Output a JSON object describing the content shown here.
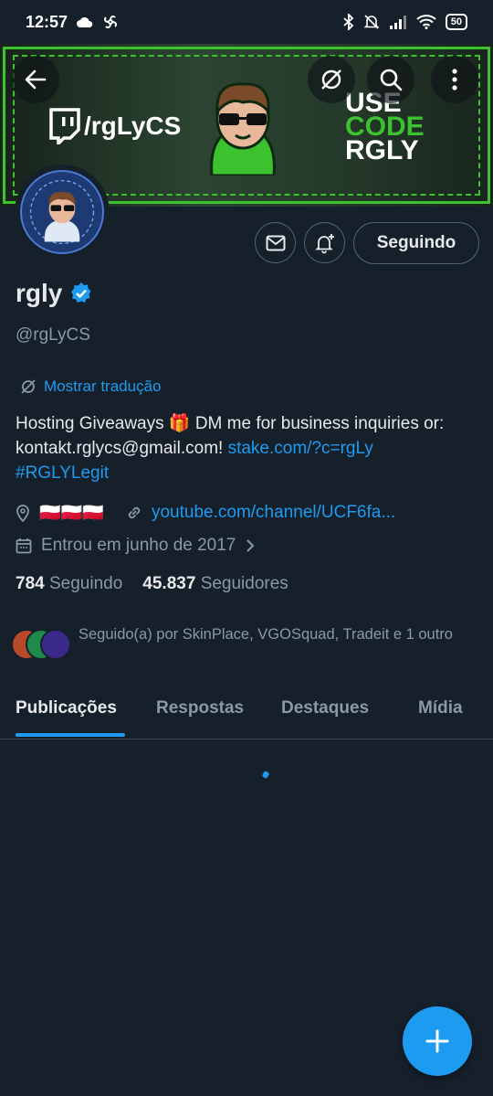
{
  "status_bar": {
    "time": "12:57",
    "battery": "50"
  },
  "banner": {
    "twitch_text": "/rgLyCS",
    "promo_line1": "USE",
    "promo_line2": "CODE",
    "promo_line3": "RGLY"
  },
  "profile": {
    "name": "rgly",
    "handle": "@rgLyCS",
    "translate_label": "Mostrar tradução",
    "bio_text": "Hosting Giveaways 🎁 DM me for business inquiries or: kontakt.rglycs@gmail.com! ",
    "bio_link": "stake.com/?c=rgLy",
    "bio_hashtag": "#RGLYLegit",
    "location": "🇵🇱🇵🇱🇵🇱",
    "website": "youtube.com/channel/UCF6fa...",
    "joined": "Entrou em junho de 2017",
    "following_count": "784",
    "following_label": "Seguindo",
    "followers_count": "45.837",
    "followers_label": "Seguidores",
    "followed_by": "Seguido(a) por SkinPlace, VGOSquad, Tradeit e 1 outro"
  },
  "actions": {
    "following_button": "Seguindo"
  },
  "tabs": [
    "Publicações",
    "Respostas",
    "Destaques",
    "Mídia"
  ],
  "colors": {
    "background": "#15202b",
    "accent": "#1d9bf0",
    "secondary_text": "#8b98a5",
    "banner_green": "#3cc22f"
  }
}
